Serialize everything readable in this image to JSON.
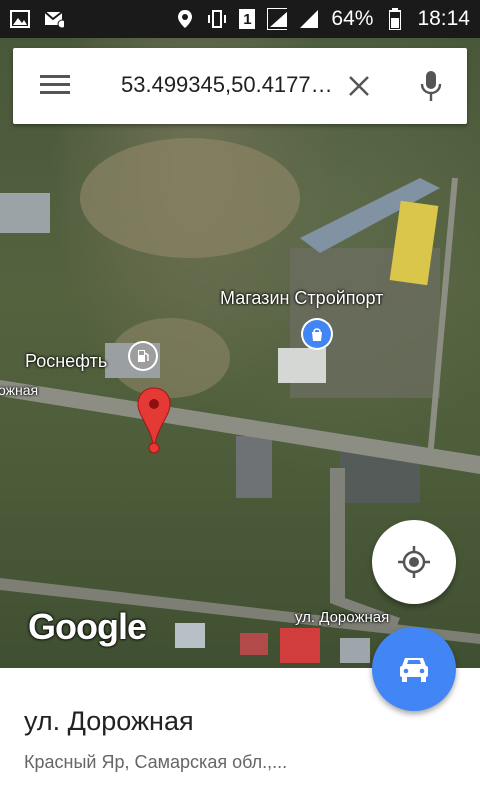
{
  "status_bar": {
    "battery_text": "64%",
    "time": "18:14",
    "sim_label": "1",
    "icons": [
      "image-icon",
      "messages-icon",
      "location-icon",
      "vibrate-icon",
      "sim-icon",
      "signal-icon",
      "signal-icon",
      "battery-icon"
    ]
  },
  "search": {
    "menu_icon": "menu-icon",
    "query": "53.499345,50.4177…",
    "clear_icon": "close-icon",
    "mic_icon": "mic-icon"
  },
  "map": {
    "labels": {
      "store": "Магазин Стройпорт",
      "gas_station": "Роснефть",
      "road_left": "ожная",
      "road_bottom": "ул. Дорожная",
      "watermark": "Google"
    },
    "colors": {
      "pin": "#e53935",
      "poi_store": "#4285f4",
      "poi_gas": "#9e9e9e"
    }
  },
  "buttons": {
    "my_location_icon": "my-location-icon",
    "directions_icon": "car-icon",
    "directions_color": "#4285f4"
  },
  "place": {
    "title": "ул. Дорожная",
    "subtitle": "Красный Яр, Самарская обл.,..."
  }
}
